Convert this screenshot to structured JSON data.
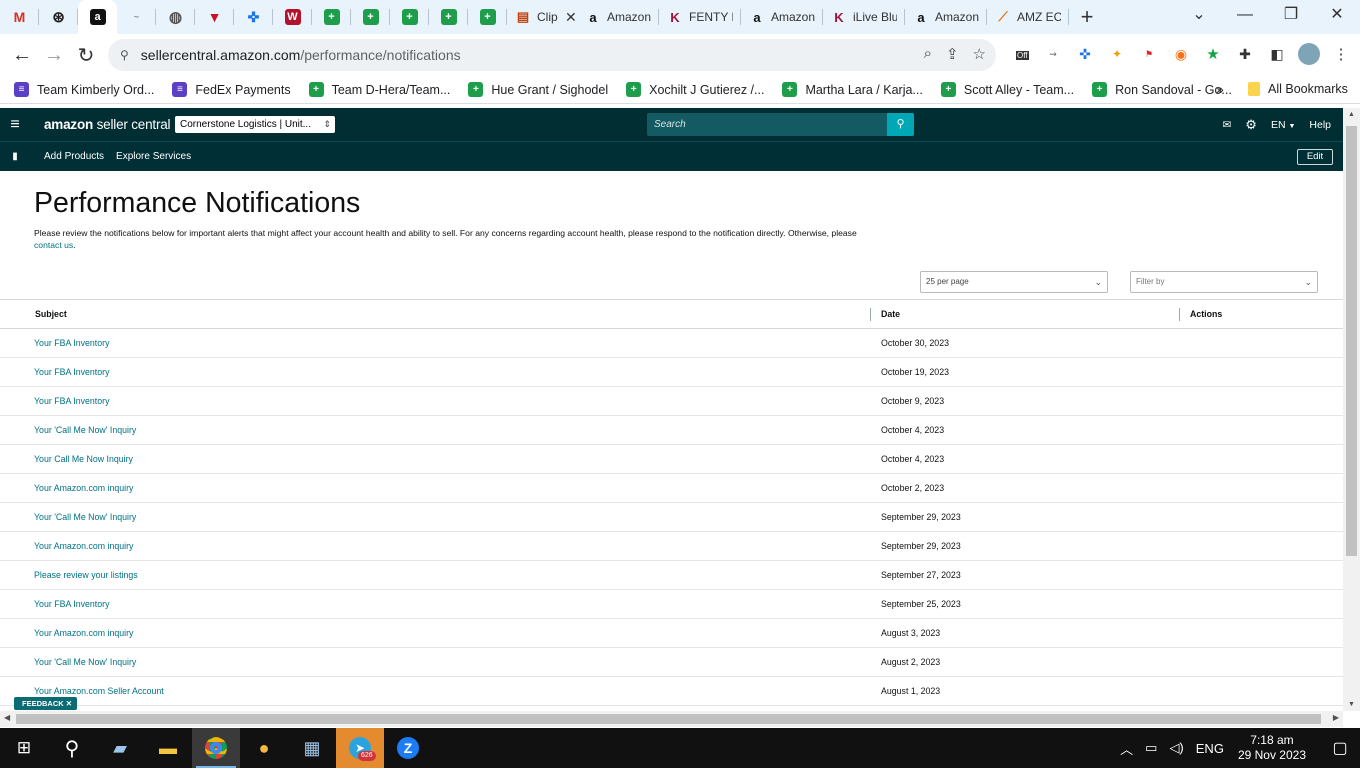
{
  "browser": {
    "tabs": [
      {
        "icon": "gmail-icon",
        "label": ""
      },
      {
        "icon": "chatgpt-icon",
        "label": ""
      },
      {
        "icon": "amazon-icon",
        "label": "",
        "active": true
      },
      {
        "icon": "site-icon",
        "label": ""
      },
      {
        "icon": "globe-icon",
        "label": ""
      },
      {
        "icon": "vivaldi-icon",
        "label": ""
      },
      {
        "icon": "compass-icon",
        "label": ""
      },
      {
        "icon": "w-icon",
        "label": ""
      },
      {
        "icon": "sheets-icon",
        "label": ""
      },
      {
        "icon": "sheets-icon",
        "label": ""
      },
      {
        "icon": "sheets-icon",
        "label": ""
      },
      {
        "icon": "sheets-icon",
        "label": ""
      },
      {
        "icon": "sheets-icon",
        "label": ""
      },
      {
        "icon": "clip-icon",
        "label": "Clip"
      },
      {
        "icon": "amazon-icon",
        "label": "Amazon"
      },
      {
        "icon": "k-icon",
        "label": "FENTY E"
      },
      {
        "icon": "amazon-icon",
        "label": "Amazon"
      },
      {
        "icon": "k-icon",
        "label": "iLive Blu"
      },
      {
        "icon": "amazon-icon",
        "label": "Amazon"
      },
      {
        "icon": "amz-icon",
        "label": "AMZ EC"
      }
    ],
    "url_domain": "sellercentral.amazon.com",
    "url_path": "/performance/notifications",
    "bookmarks": [
      "Team Kimberly Ord...",
      "FedEx Payments",
      "Team D-Hera/Team...",
      "Hue Grant / Sighodel",
      "Xochilt J Gutierez /...",
      "Martha Lara / Karja...",
      "Scott Alley - Team...",
      "Ron Sandoval - Go..."
    ],
    "all_bookmarks": "All Bookmarks",
    "ext_off_label": "Off"
  },
  "seller_central": {
    "logo_brand": "amazon",
    "logo_product": "seller central",
    "account_selector": "Cornerstone Logistics | Unit...",
    "search_placeholder": "Search",
    "language": "EN",
    "help": "Help",
    "nav_links": [
      "Add Products",
      "Explore Services"
    ],
    "edit": "Edit"
  },
  "page": {
    "title": "Performance Notifications",
    "description": "Please review the notifications below for important alerts that might affect your account health and ability to sell. For any concerns regarding account health, please respond to the notification directly. Otherwise, please",
    "contact_link": "contact us",
    "contact_suffix": ".",
    "per_page": "25 per page",
    "filter_by": "Filter by",
    "columns": {
      "subject": "Subject",
      "date": "Date",
      "actions": "Actions"
    },
    "rows": [
      {
        "subject": "Your FBA Inventory",
        "date": "October 30, 2023"
      },
      {
        "subject": "Your FBA Inventory",
        "date": "October 19, 2023"
      },
      {
        "subject": "Your FBA Inventory",
        "date": "October 9, 2023"
      },
      {
        "subject": "Your 'Call Me Now' Inquiry",
        "date": "October 4, 2023"
      },
      {
        "subject": "Your Call Me Now Inquiry",
        "date": "October 4, 2023"
      },
      {
        "subject": "Your Amazon.com inquiry",
        "date": "October 2, 2023"
      },
      {
        "subject": "Your 'Call Me Now' Inquiry",
        "date": "September 29, 2023"
      },
      {
        "subject": "Your Amazon.com inquiry",
        "date": "September 29, 2023"
      },
      {
        "subject": "Please review your listings",
        "date": "September 27, 2023"
      },
      {
        "subject": "Your FBA Inventory",
        "date": "September 25, 2023"
      },
      {
        "subject": "Your Amazon.com inquiry",
        "date": "August 3, 2023"
      },
      {
        "subject": "Your 'Call Me Now' Inquiry",
        "date": "August 2, 2023"
      },
      {
        "subject": "Your Amazon.com Seller Account",
        "date": "August 1, 2023"
      }
    ],
    "feedback": "FEEDBACK"
  },
  "taskbar": {
    "telegram_badge": "626",
    "language": "ENG",
    "time": "7:18 am",
    "date": "29 Nov 2023"
  },
  "colors": {
    "header_bg": "#012e33",
    "link": "#007185",
    "search_button": "#00a8b5"
  }
}
